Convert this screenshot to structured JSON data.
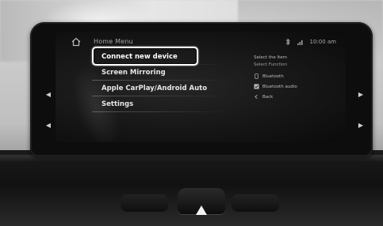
{
  "screen": {
    "title": "Home Menu",
    "status_time": "10:00 am"
  },
  "menu": {
    "items": [
      {
        "label": "Connect new device"
      },
      {
        "label": "Screen Mirroring"
      },
      {
        "label": "Apple CarPlay/Android Auto"
      },
      {
        "label": "Settings"
      }
    ],
    "selected_index": 0
  },
  "right_panel": {
    "heading": "Select the Item",
    "subheading": "Select Function",
    "items": [
      {
        "label": "Bluetooth",
        "icon": "phone-icon"
      },
      {
        "label": "Bluetooth audio",
        "icon": "check-icon"
      },
      {
        "label": "Back",
        "icon": "back-icon"
      }
    ]
  },
  "controls": {
    "left_arrow_upper": "◀",
    "left_arrow_lower": "◀",
    "right_arrow_upper": "▶",
    "right_arrow_lower": "▶"
  },
  "colors": {
    "selection": "#ffffff",
    "screen_bg": "#151515",
    "text": "#e6e6e6"
  }
}
